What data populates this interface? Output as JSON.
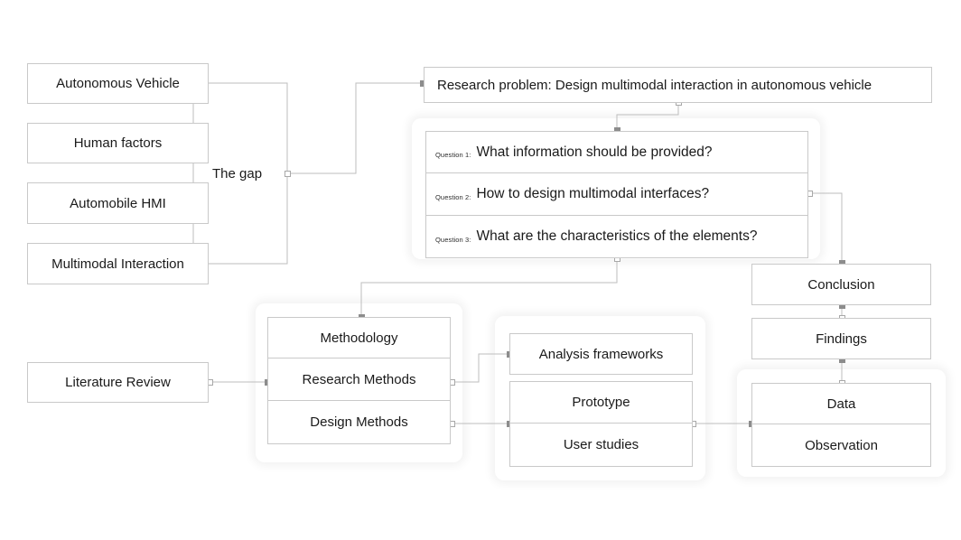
{
  "diagram": {
    "title": "Research framework flow diagram",
    "colors": {
      "box_border": "#c9c9c9",
      "wire": "#bdbdbd",
      "handle_filled": "#8c8c8c",
      "handle_hollow": "#ffffff",
      "text": "#1a1a1a",
      "background": "#ffffff"
    }
  },
  "background_topics": {
    "items": [
      {
        "label": "Autonomous Vehicle"
      },
      {
        "label": "Human factors"
      },
      {
        "label": "Automobile HMI"
      },
      {
        "label": "Multimodal Interaction"
      }
    ],
    "bracket_label": "The gap"
  },
  "research_problem": {
    "label": "Research problem: Design multimodal interaction in autonomous vehicle"
  },
  "research_questions": {
    "items": [
      {
        "number": "Question 1:",
        "text": "What information should be provided?"
      },
      {
        "number": "Question 2:",
        "text": "How to design multimodal interfaces?"
      },
      {
        "number": "Question 3:",
        "text": "What are the characteristics of the elements?"
      }
    ]
  },
  "literature": {
    "label": "Literature Review"
  },
  "methodology_group": {
    "items": [
      {
        "label": "Methodology"
      },
      {
        "label": "Research Methods"
      },
      {
        "label": "Design Methods"
      }
    ]
  },
  "methods_group": {
    "analysis": "Analysis frameworks",
    "prototype": "Prototype",
    "user_studies": "User studies"
  },
  "outcomes": {
    "conclusion": "Conclusion",
    "findings": "Findings",
    "data": "Data",
    "observation": "Observation"
  }
}
